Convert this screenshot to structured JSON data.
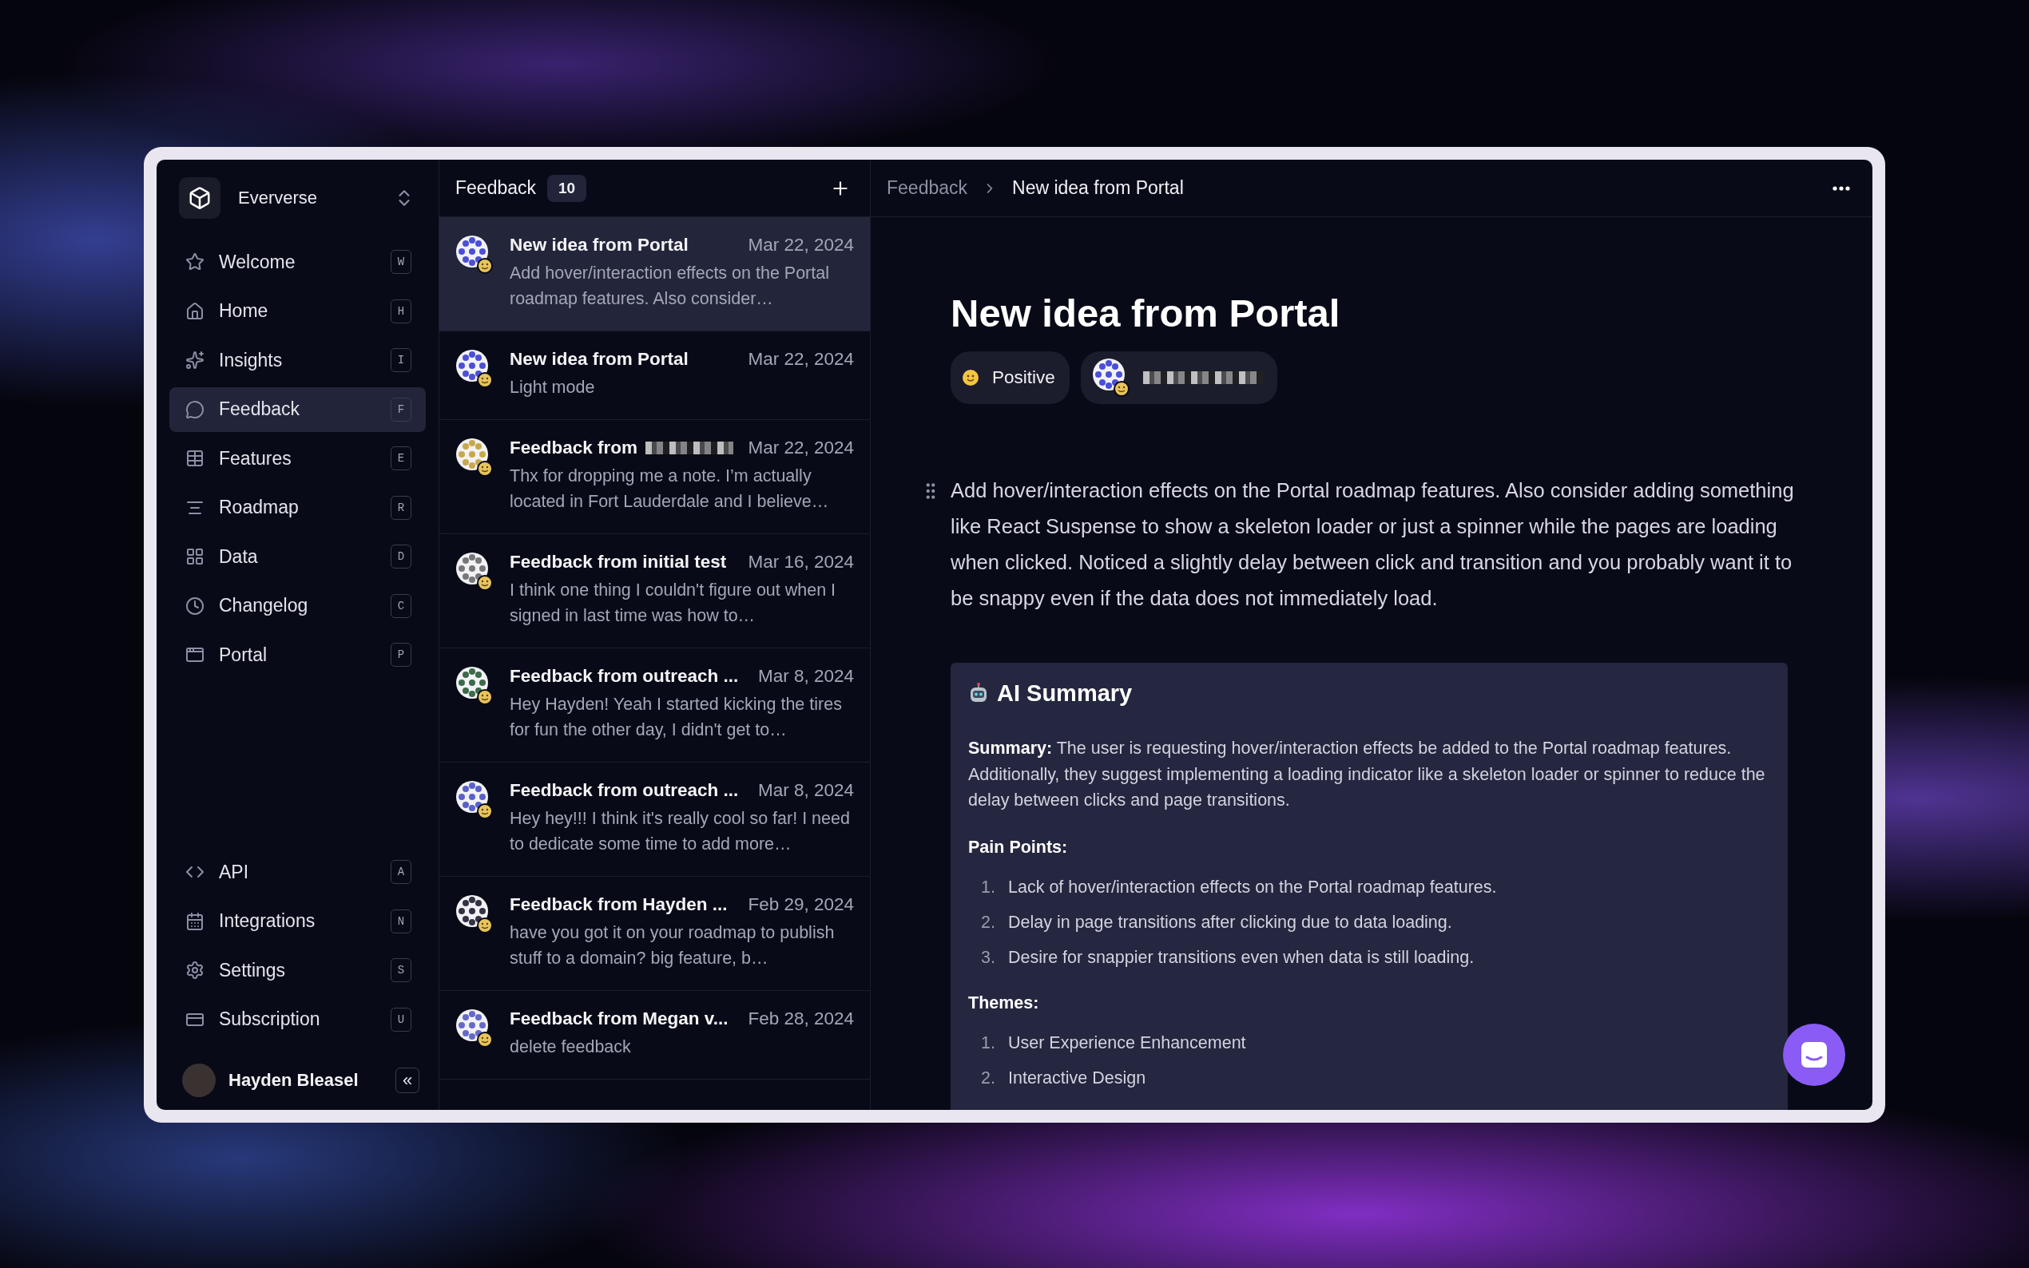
{
  "workspace": {
    "name": "Eververse"
  },
  "nav": [
    {
      "label": "Welcome",
      "shortcut": "W",
      "selected": false
    },
    {
      "label": "Home",
      "shortcut": "H",
      "selected": false
    },
    {
      "label": "Insights",
      "shortcut": "I",
      "selected": false
    },
    {
      "label": "Feedback",
      "shortcut": "F",
      "selected": true
    },
    {
      "label": "Features",
      "shortcut": "E",
      "selected": false
    },
    {
      "label": "Roadmap",
      "shortcut": "R",
      "selected": false
    },
    {
      "label": "Data",
      "shortcut": "D",
      "selected": false
    },
    {
      "label": "Changelog",
      "shortcut": "C",
      "selected": false
    },
    {
      "label": "Portal",
      "shortcut": "P",
      "selected": false
    }
  ],
  "nav_bottom": [
    {
      "label": "API",
      "shortcut": "A",
      "selected": false
    },
    {
      "label": "Integrations",
      "shortcut": "N",
      "selected": false
    },
    {
      "label": "Settings",
      "shortcut": "S",
      "selected": false
    },
    {
      "label": "Subscription",
      "shortcut": "U",
      "selected": false
    }
  ],
  "user": {
    "name": "Hayden Bleasel",
    "collapse": "«"
  },
  "list": {
    "title": "Feedback",
    "count": "10",
    "items": [
      {
        "title": "New idea from Portal",
        "date": "Mar 22, 2024",
        "preview": "Add hover/interaction effects on the Portal roadmap features. Also consider…",
        "selected": true,
        "redacted": false
      },
      {
        "title": "New idea from Portal",
        "date": "Mar 22, 2024",
        "preview": "Light mode",
        "selected": false,
        "redacted": false
      },
      {
        "title": "Feedback from",
        "date": "Mar 22, 2024",
        "preview": "Thx for dropping me a note. I’m actually located in Fort Lauderdale and I believe…",
        "selected": false,
        "redacted": true
      },
      {
        "title": "Feedback from initial test",
        "date": "Mar 16, 2024",
        "preview": "I think one thing I couldn't figure out when I signed in last time was how to…",
        "selected": false,
        "redacted": false
      },
      {
        "title": "Feedback from outreach ...",
        "date": "Mar 8, 2024",
        "preview": "Hey Hayden!  Yeah I started kicking the tires for fun the other day, I didn't get to…",
        "selected": false,
        "redacted": false
      },
      {
        "title": "Feedback from outreach ...",
        "date": "Mar 8, 2024",
        "preview": "Hey hey!!! I think it's really cool so far! I need to dedicate some time to add more…",
        "selected": false,
        "redacted": false
      },
      {
        "title": "Feedback from Hayden ...",
        "date": "Feb 29, 2024",
        "preview": "have you got it on your roadmap to publish stuff to a domain? big feature, b…",
        "selected": false,
        "redacted": false
      },
      {
        "title": "Feedback from Megan v...",
        "date": "Feb 28, 2024",
        "preview": "delete feedback",
        "selected": false,
        "redacted": false
      }
    ]
  },
  "detail": {
    "breadcrumb": [
      "Feedback",
      "New idea from Portal"
    ],
    "title": "New idea from Portal",
    "sentiment": "Positive",
    "author_redacted": true,
    "body": "Add hover/interaction effects on the Portal roadmap features. Also consider adding something like React Suspense to show a skeleton loader or just a spinner while the pages are loading when clicked. Noticed a slightly delay between click and transition and you probably want it to be snappy even if the data does not immediately load.",
    "summary": {
      "heading": "AI Summary",
      "text": "**Summary:** The user is requesting hover/interaction effects be added to the Portal roadmap features. Additionally, they suggest implementing a loading indicator like a skeleton loader or spinner to reduce the delay between clicks and page transitions.",
      "sections": [
        {
          "heading": "Pain Points:",
          "items": [
            {
              "number": "1.",
              "text": "Lack of hover/interaction effects on the Portal roadmap features."
            },
            {
              "number": "2.",
              "text": "Delay in page transitions after clicking due to data loading."
            },
            {
              "number": "3.",
              "text": "Desire for snappier transitions even when data is still loading."
            }
          ]
        },
        {
          "heading": "Themes:",
          "items": [
            {
              "number": "1.",
              "text": "User Experience Enhancement"
            },
            {
              "number": "2.",
              "text": "Interactive Design"
            }
          ]
        }
      ]
    }
  }
}
